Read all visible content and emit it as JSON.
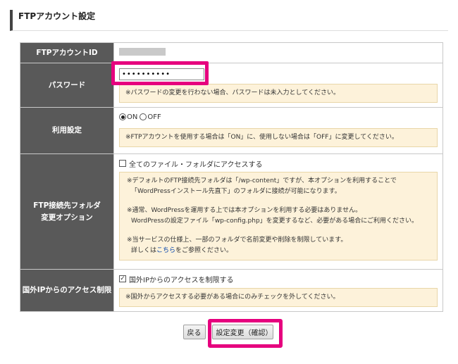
{
  "page": {
    "title": "FTPアカウント設定"
  },
  "rows": {
    "account_id": {
      "label": "FTPアカウントID"
    },
    "password": {
      "label": "パスワード",
      "value": "••••••••••",
      "note": "※パスワードの変更を行わない場合、パスワードは未入力としてください。"
    },
    "usage": {
      "label": "利用設定",
      "on_label": "ON",
      "off_label": "OFF",
      "selected": "ON",
      "note": "※FTPアカウントを使用する場合は「ON」に、使用しない場合は「OFF」に変更してください。"
    },
    "folder": {
      "label_line1": "FTP接続先フォルダ",
      "label_line2": "変更オプション",
      "checkbox_label": "全てのファイル・フォルダにアクセスする",
      "checked": false,
      "note1_line1": "※デフォルトのFTP接続先フォルダは「/wp-content」ですが、本オプションを利用することで",
      "note1_line2": "「WordPressインストール先直下」のフォルダに接続が可能になります。",
      "note2_line1": "※通常、WordPressを運用する上では本オプションを利用する必要はありません。",
      "note2_line2": "WordPressの設定ファイル「wp-config.php」を変更するなど、必要がある場合にご利用ください。",
      "note3_line1": "※当サービスの仕様上、一部のフォルダで名前変更や削除を制限しています。",
      "note3_line2_prefix": "詳しくは",
      "note3_link": "こちら",
      "note3_line2_suffix": "をご参照ください。"
    },
    "foreign_ip": {
      "label": "国外IPからのアクセス制限",
      "checkbox_label": "国外IPからのアクセスを制限する",
      "checked": true,
      "check_mark": "✓",
      "note": "※国外からアクセスする必要がある場合にのみチェックを外してください。"
    }
  },
  "buttons": {
    "back": "戻る",
    "confirm": "設定変更（確認）"
  },
  "colors": {
    "highlight": "#e6007e",
    "header_bg": "#595959",
    "note_bg": "#fdf2da"
  }
}
